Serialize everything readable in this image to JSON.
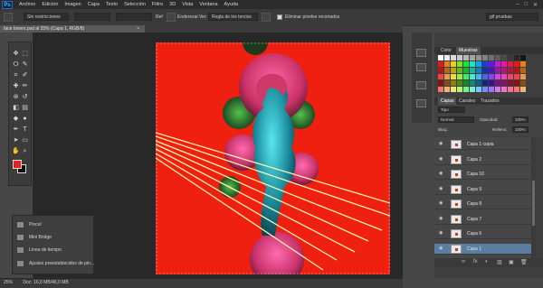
{
  "app": {
    "logo": "Ps"
  },
  "menu": [
    "Archivo",
    "Edición",
    "Imagen",
    "Capa",
    "Texto",
    "Selección",
    "Filtro",
    "3D",
    "Vista",
    "Ventana",
    "Ayuda"
  ],
  "window_controls": [
    "–",
    "□",
    "✕"
  ],
  "options_bar": {
    "style_value": "Sin restricciones",
    "resize_label": "Ref",
    "smooth_label": "Enderezar",
    "view_label": "Ver:",
    "view_value": "Regla de los tercios",
    "delete_pixels_label": "Eliminar píxeles recortados",
    "workspace_value": "gif pruebas"
  },
  "document": {
    "tab_title": "face bones.psd al 25% (Capa 1, RGB/8)",
    "close": "×"
  },
  "status": {
    "zoom": "25%",
    "doc_info": "Doc: 16,0 MB/46,0 MB"
  },
  "tools": [
    {
      "name": "move-tool",
      "glyph": "✥"
    },
    {
      "name": "marquee-tool",
      "glyph": "⬚"
    },
    {
      "name": "lasso-tool",
      "glyph": "ⵔ"
    },
    {
      "name": "quick-select-tool",
      "glyph": "✎"
    },
    {
      "name": "crop-tool",
      "glyph": "⌗"
    },
    {
      "name": "eyedropper-tool",
      "glyph": "✐"
    },
    {
      "name": "healing-tool",
      "glyph": "✚"
    },
    {
      "name": "brush-tool",
      "glyph": "✏"
    },
    {
      "name": "stamp-tool",
      "glyph": "⊛"
    },
    {
      "name": "history-brush-tool",
      "glyph": "↺"
    },
    {
      "name": "eraser-tool",
      "glyph": "◧"
    },
    {
      "name": "gradient-tool",
      "glyph": "▤"
    },
    {
      "name": "blur-tool",
      "glyph": "◆"
    },
    {
      "name": "dodge-tool",
      "glyph": "●"
    },
    {
      "name": "pen-tool",
      "glyph": "✒"
    },
    {
      "name": "type-tool",
      "glyph": "T"
    },
    {
      "name": "path-select-tool",
      "glyph": "➤"
    },
    {
      "name": "shape-tool",
      "glyph": "▭"
    },
    {
      "name": "hand-tool",
      "glyph": "✋"
    },
    {
      "name": "zoom-tool",
      "glyph": "⌕"
    }
  ],
  "floating_panel": {
    "items": [
      "Pincel",
      "Mini Bridge",
      "Línea de tiempo",
      "Ajustes preestablecidos de pin..."
    ]
  },
  "color_panel": {
    "tabs": [
      "Color",
      "Muestras"
    ],
    "active": 1
  },
  "layers_panel": {
    "tabs": [
      "Capas",
      "Canales",
      "Trazados"
    ],
    "filter_label": "Tipo",
    "blend_mode": "Normal",
    "opacity_label": "Opacidad:",
    "opacity_value": "100%",
    "lock_label": "Bloq.:",
    "fill_label": "Relleno:",
    "fill_value": "100%",
    "layers": [
      "Capa 1 copia",
      "Capa 2",
      "Capa 10",
      "Capa 9",
      "Capa 8",
      "Capa 7",
      "Capa 6",
      "Capa 1"
    ],
    "selected_index": 7,
    "footer_icons": [
      "∞",
      "fx",
      "◐",
      "▥",
      "▣",
      "🗑"
    ]
  },
  "colors": {
    "canvas_bg": "#ef2010",
    "accent_selection": "#5a7ea0"
  }
}
